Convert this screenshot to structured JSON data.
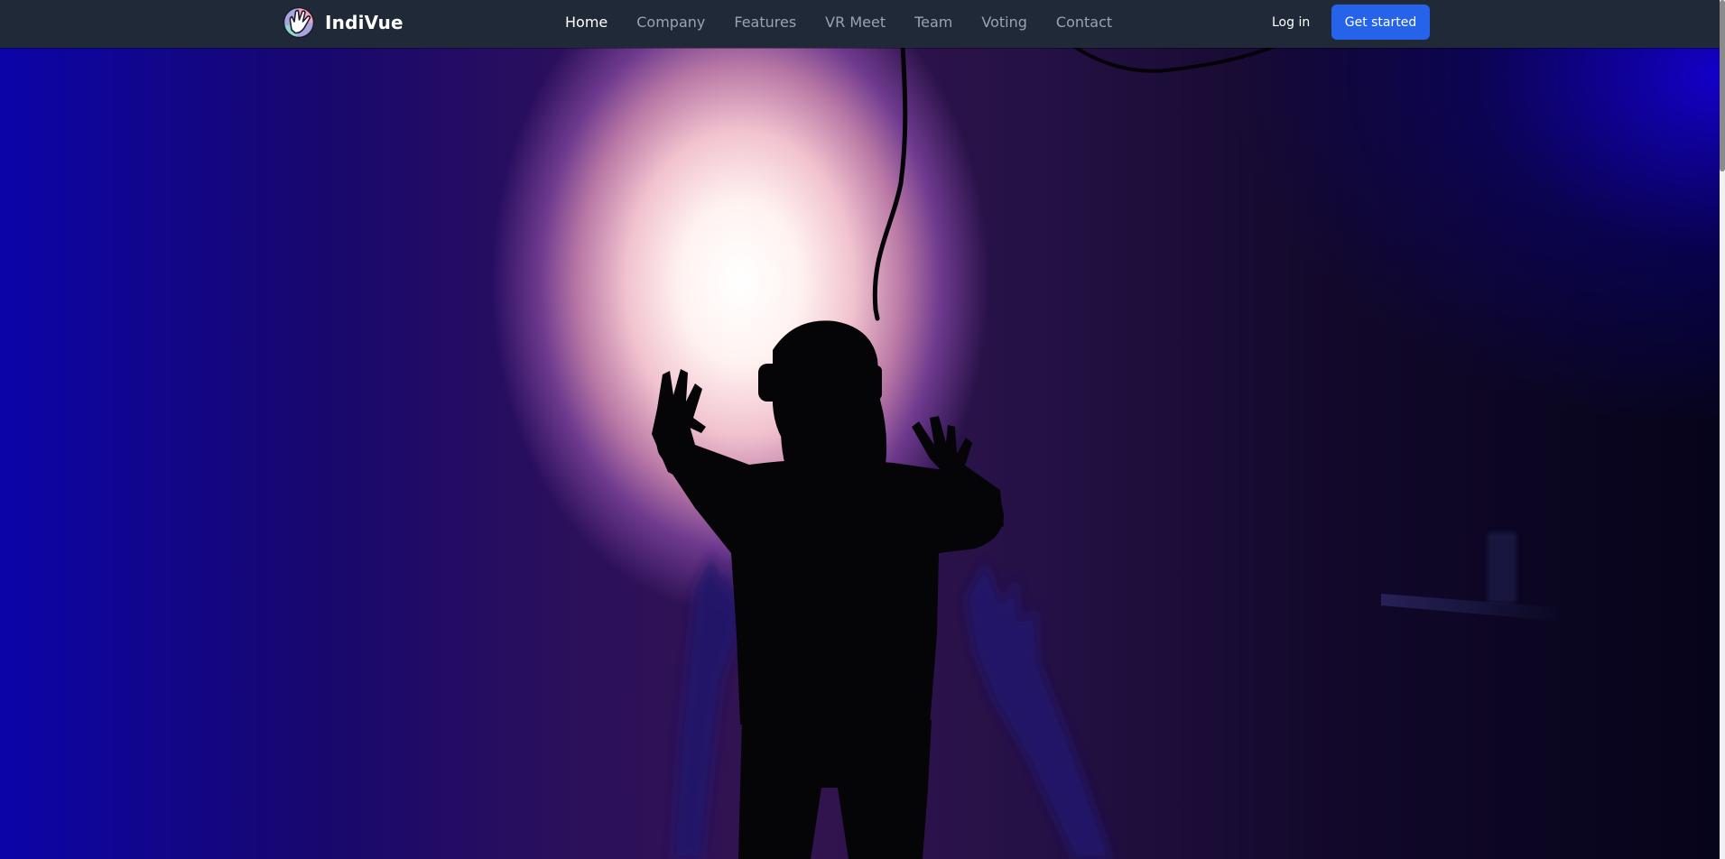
{
  "brand": {
    "name": "IndiVue",
    "logo_icon": "indivue-hand-logo-icon"
  },
  "nav": {
    "items": [
      {
        "label": "Home",
        "active": true
      },
      {
        "label": "Company",
        "active": false
      },
      {
        "label": "Features",
        "active": false
      },
      {
        "label": "VR Meet",
        "active": false
      },
      {
        "label": "Team",
        "active": false
      },
      {
        "label": "Voting",
        "active": false
      },
      {
        "label": "Contact",
        "active": false
      }
    ]
  },
  "actions": {
    "login_label": "Log in",
    "cta_label": "Get started"
  },
  "colors": {
    "navbar_bg": "#1f2937",
    "nav_text": "#9ca3af",
    "nav_active": "#ffffff",
    "cta_bg": "#2563eb",
    "hero_glow": "#fff3f1",
    "hero_blue": "#0c04a8"
  },
  "hero": {
    "image": "vr-user-silhouette-photo"
  }
}
